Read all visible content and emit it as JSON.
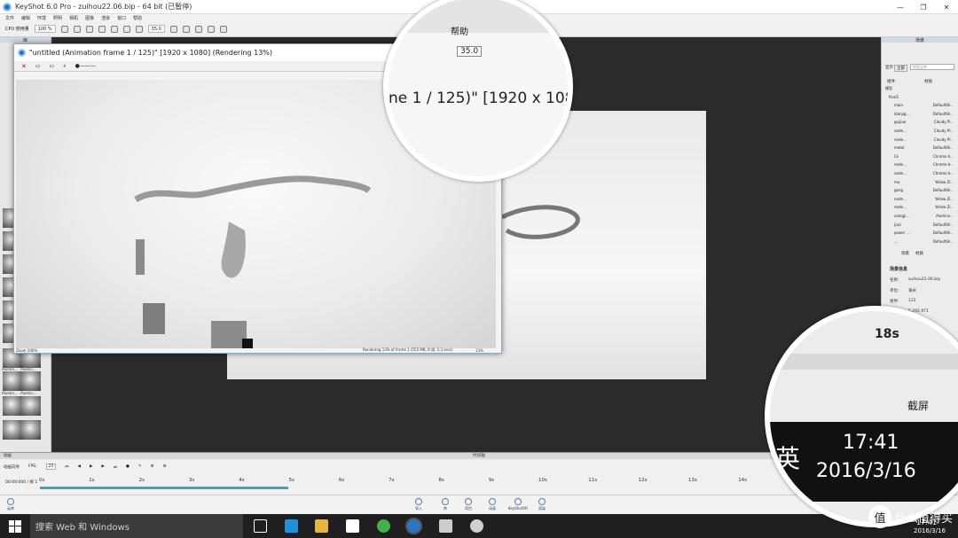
{
  "app": {
    "title": "KeyShot 6.0 Pro  - zuihou22.06.bip  - 64 bit (已暂停)"
  },
  "menu": [
    "文件",
    "编辑",
    "环境",
    "照明",
    "相机",
    "图像",
    "渲染",
    "窗口",
    "帮助"
  ],
  "toolbar": {
    "cpu_label": "CPU 使用量",
    "cpu_value": "100 %",
    "fov_value": "35.0"
  },
  "left_panel": {
    "title": "库",
    "thumb_label": "Alumin..."
  },
  "render_window": {
    "title": "\"untitled (Animation frame 1 / 125)\" [1920 x 1080] (Rendering 13%)",
    "zoom": "Zoom 100%",
    "status": "Rendering 13% of frame 1 (555 MB, 8 线, 3.3 secs)",
    "progress_pct": "13%"
  },
  "right_panel": {
    "title": "场景",
    "tabs": [
      "显示",
      "全部"
    ],
    "search_placeholder": "搜索全称",
    "col_component": "组件",
    "col_material": "材质",
    "tree": [
      {
        "name": "模型",
        "mat": ""
      },
      {
        "name": "final1",
        "mat": ""
      },
      {
        "name": "main",
        "mat": "DefaultSh.."
      },
      {
        "name": "dianjig...",
        "mat": "DefaultSh.."
      },
      {
        "name": "guijiao",
        "mat": "Cloudy Pl.."
      },
      {
        "name": "node...",
        "mat": "Cloudy Pl.."
      },
      {
        "name": "node...",
        "mat": "Cloudy Pl.."
      },
      {
        "name": "metal",
        "mat": "DefaultSh.."
      },
      {
        "name": "LS",
        "mat": "Chrome b.."
      },
      {
        "name": "node...",
        "mat": "Chrome b.."
      },
      {
        "name": "node...",
        "mat": "Chrome b.."
      },
      {
        "name": "mu",
        "mat": "Yellow Zi.."
      },
      {
        "name": "gong",
        "mat": "DefaultSh.."
      },
      {
        "name": "node...",
        "mat": "Yellow Zi.."
      },
      {
        "name": "node...",
        "mat": "Yellow Zi.."
      },
      {
        "name": "xiangji...",
        "mat": "Aluminu.."
      },
      {
        "name": "jiazi",
        "mat": "DefaultSh.."
      },
      {
        "name": "power ...",
        "mat": "DefaultSh.."
      },
      {
        "name": "...",
        "mat": "DefaultSh.."
      }
    ],
    "bottom_tabs": [
      "场景",
      "材质"
    ],
    "info_title": "场景信息",
    "info": [
      {
        "label": "名称:",
        "value": "zuihou22.06.bip"
      },
      {
        "label": "单位:",
        "value": "毫米"
      },
      {
        "label": "组件:",
        "value": "122"
      },
      {
        "label": "三角形:",
        "value": "5,292,971"
      }
    ]
  },
  "timeline": {
    "title": "时间轴",
    "section": "动画",
    "wizard": "动画向导",
    "fps_label": "FPS:",
    "fps_value": "25",
    "frame_readout": "00:00:000 / 帧 1",
    "ticks": [
      "0s",
      "1s",
      "2s",
      "3s",
      "4s",
      "5s",
      "6s",
      "7s",
      "8s",
      "9s",
      "10s",
      "11s",
      "12s",
      "13s",
      "14s",
      "18s"
    ],
    "progress_fraction": 0.27
  },
  "bottombar": {
    "left": "云库",
    "items": [
      "导入",
      "库",
      "项目",
      "动画",
      "KeyShotVR",
      "渲染"
    ]
  },
  "zoom_top": {
    "menu": "帮助",
    "value": "35.0",
    "text": "ne 1 / 125)\" [1920 x 1080"
  },
  "zoom_bottom": {
    "tick": "18s",
    "shot_label": "截屏",
    "ime": "英",
    "time": "17:41",
    "date": "2016/3/16"
  },
  "taskbar": {
    "search": "搜索 Web 和 Windows",
    "time": "17:41",
    "date": "2016/3/16"
  },
  "watermark": {
    "text": "什么值得买",
    "badge": "值"
  }
}
